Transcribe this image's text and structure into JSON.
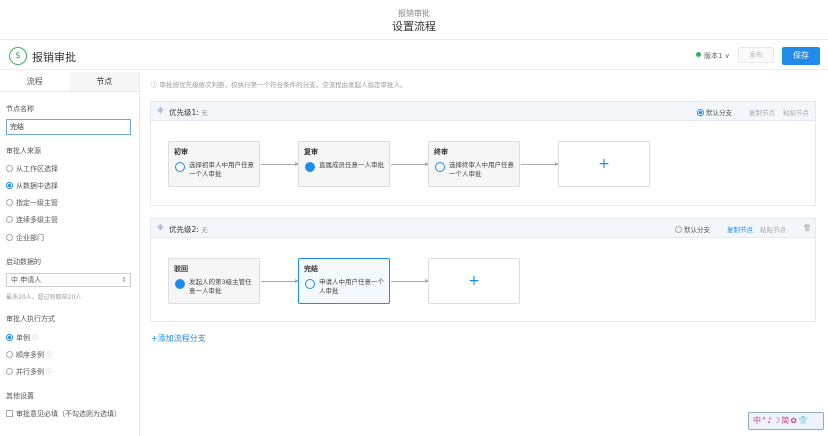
{
  "topbar": {
    "subtitle": "报销审批",
    "title": "设置流程"
  },
  "header": {
    "app_icon": "dollar-icon",
    "app_icon_glyph": "$",
    "name": "报销审批",
    "version": "版本1 ∨",
    "publish": "发布",
    "save": "保存"
  },
  "left": {
    "tabs": [
      "流程",
      "节点"
    ],
    "node_name_label": "节点名称",
    "node_name_value": "完结",
    "source_label": "审批人来源",
    "source_options": [
      "从工作区选择",
      "从数据中选择",
      "指定一级主管",
      "连续多级主管",
      "企业部门"
    ],
    "dataset_label": "启动数据的",
    "dataset_value": "中 申请人",
    "dataset_hint": "最多20人，超过则取前20人",
    "exec_label": "审批人执行方式",
    "exec_options": [
      "单例",
      "顺序多例",
      "并行多例"
    ],
    "other_label": "其他设置",
    "other_check": "审批意见必填（不勾选则为选填）"
  },
  "tip": "审批按优先级依次判断，仅执行第一个符合条件的分支，空流程由发起人指定审批人。",
  "lanes": [
    {
      "title": "优先级1:",
      "cond": "无",
      "default_branch": "默认分支",
      "copy": "复制节点",
      "paste": "粘贴节点",
      "nodes": [
        {
          "title": "初审",
          "text": "选择初审人中用户任意一个人审批"
        },
        {
          "title": "复审",
          "text": "直属成员任意一人审批"
        },
        {
          "title": "终审",
          "text": "选择终审人中用户任意一个人审批"
        }
      ],
      "add": "+"
    },
    {
      "title": "优先级2:",
      "cond": "无",
      "default_branch": "默认分支",
      "copy": "复制节点",
      "paste": "粘贴节点",
      "nodes": [
        {
          "title": "驳回",
          "text": "发起人的第3级主管任意一人审批"
        },
        {
          "title": "完结",
          "text": "申请人中用户任意一个人审批"
        }
      ],
      "add": "+"
    }
  ],
  "add_branch": "+添加流程分支",
  "ime": "中°♪☽简✿👕",
  "colors": {
    "accent": "#1f8ceb",
    "success": "#3bb35c"
  }
}
